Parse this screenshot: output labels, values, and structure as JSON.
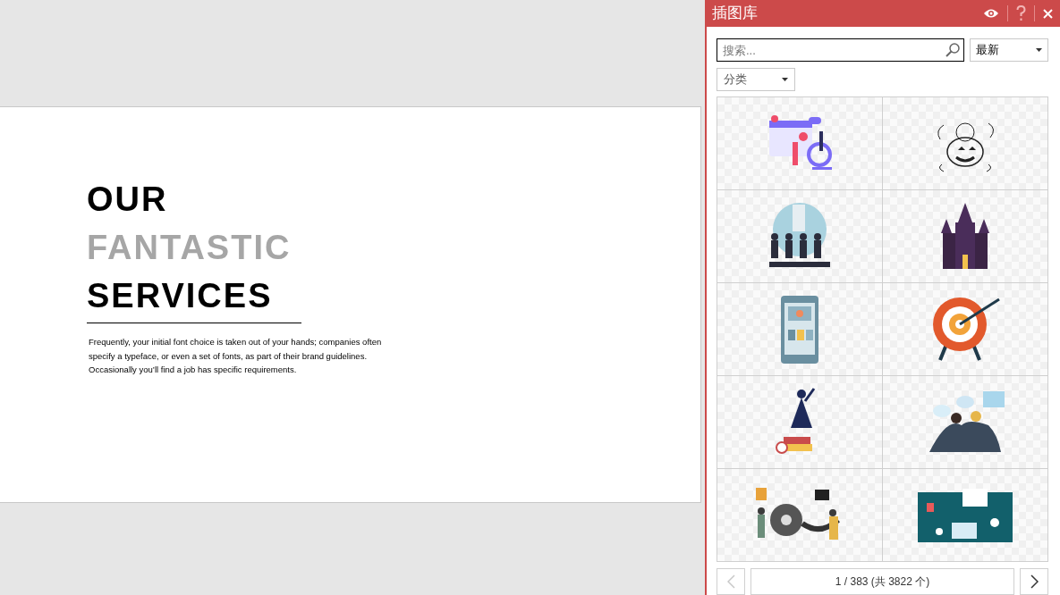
{
  "slide": {
    "title_lines": [
      {
        "text": "OUR",
        "color": "#000000"
      },
      {
        "text": "FANTASTIC",
        "color": "#a6a6a6"
      },
      {
        "text": "SERVICES",
        "color": "#000000"
      }
    ],
    "body": "Frequently, your initial font choice is taken out of your hands; companies often specify a typeface, or even a set of fonts, as part of their brand guidelines. Occasionally you’ll find a job has specific requirements."
  },
  "panel": {
    "title": "插图库",
    "search": {
      "placeholder": "搜索..."
    },
    "sort": {
      "value": "最新"
    },
    "category": {
      "value": "分类"
    },
    "items": [
      {
        "kind": "calendar"
      },
      {
        "kind": "pumpkin"
      },
      {
        "kind": "people"
      },
      {
        "kind": "castle"
      },
      {
        "kind": "phone"
      },
      {
        "kind": "target"
      },
      {
        "kind": "graduate"
      },
      {
        "kind": "chat"
      },
      {
        "kind": "film"
      },
      {
        "kind": "desk"
      }
    ],
    "pagination": {
      "label": "1 / 383 (共 3822 个)",
      "prev_disabled": true,
      "next_disabled": false
    }
  }
}
